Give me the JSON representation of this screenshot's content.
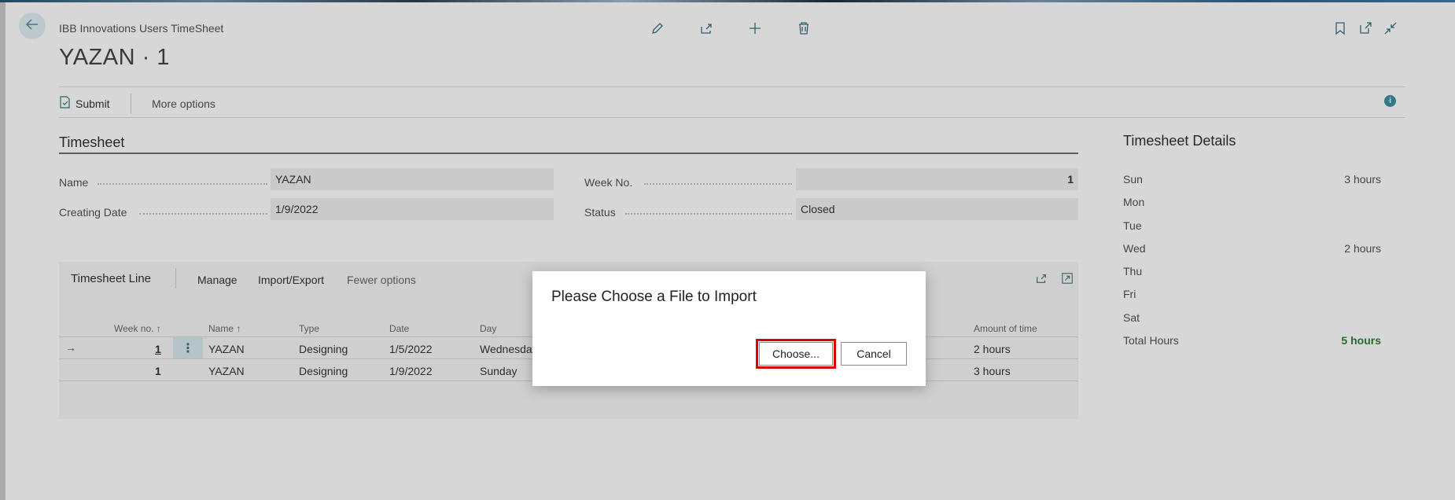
{
  "header": {
    "caption": "IBB Innovations Users TimeSheet",
    "title": "YAZAN · 1"
  },
  "actions": {
    "submit_label": "Submit",
    "more_options_label": "More options"
  },
  "timesheet": {
    "section_title": "Timesheet",
    "name_label": "Name",
    "name_value": "YAZAN",
    "creating_date_label": "Creating Date",
    "creating_date_value": "1/9/2022",
    "week_no_label": "Week No.",
    "week_no_value": "1",
    "status_label": "Status",
    "status_value": "Closed"
  },
  "lines": {
    "title": "Timesheet Line",
    "manage_label": "Manage",
    "import_export_label": "Import/Export",
    "fewer_options_label": "Fewer options",
    "columns": [
      "Week no. ↑",
      "Name ↑",
      "Type",
      "Date",
      "Day",
      "Amount of time"
    ],
    "rows": [
      [
        "1",
        "YAZAN",
        "Designing",
        "1/5/2022",
        "Wednesday",
        "2 hours"
      ],
      [
        "1",
        "YAZAN",
        "Designing",
        "1/9/2022",
        "Sunday",
        "3 hours"
      ]
    ]
  },
  "details": {
    "title": "Timesheet Details",
    "rows": [
      {
        "label": "Sun",
        "value": "3 hours"
      },
      {
        "label": "Mon",
        "value": ""
      },
      {
        "label": "Tue",
        "value": ""
      },
      {
        "label": "Wed",
        "value": "2 hours"
      },
      {
        "label": "Thu",
        "value": ""
      },
      {
        "label": "Fri",
        "value": ""
      },
      {
        "label": "Sat",
        "value": ""
      }
    ],
    "total_label": "Total Hours",
    "total_value": "5 hours",
    "total_color": "#2e7d32"
  },
  "dialog": {
    "title": "Please Choose a File to Import",
    "choose_label": "Choose...",
    "cancel_label": "Cancel",
    "highlight_color": "#e00000"
  },
  "icons": [
    "back-arrow-icon",
    "edit-icon",
    "share-icon",
    "add-icon",
    "delete-icon",
    "bookmark-icon",
    "open-new-window-icon",
    "collapse-icon",
    "submit-icon",
    "info-icon",
    "row-arrow-icon",
    "row-menu-icon",
    "grid-share-icon",
    "grid-expand-icon"
  ]
}
